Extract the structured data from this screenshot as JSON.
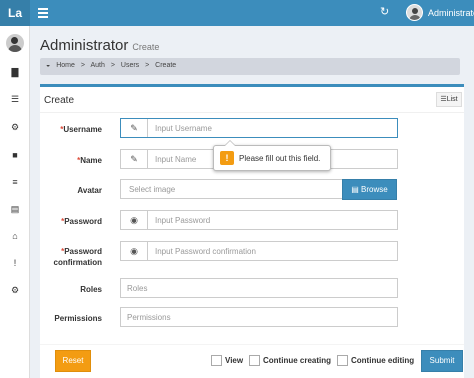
{
  "header": {
    "logo": "La",
    "user_name": "Administrator"
  },
  "page": {
    "title": "Administrator",
    "subtitle": "Create"
  },
  "breadcrumb": [
    {
      "label": "Home",
      "icon": "dashboard-icon"
    },
    {
      "label": ">"
    },
    {
      "label": "Auth"
    },
    {
      "label": ">"
    },
    {
      "label": "Users"
    },
    {
      "label": ">"
    },
    {
      "label": "Create"
    }
  ],
  "sidebar": {
    "icons": [
      "bar-chart-icon",
      "list-icon",
      "cogs-icon",
      "file-icon",
      "sliders-icon",
      "database-icon",
      "bank-icon",
      "exclamation-icon",
      "gears-icon"
    ]
  },
  "form": {
    "title": "Create",
    "list_button": "List",
    "username": {
      "label": "Username",
      "placeholder": "Input Username",
      "icon": "pencil-icon"
    },
    "name": {
      "label": "Name",
      "placeholder": "Input Name",
      "icon": "pencil-icon"
    },
    "avatar": {
      "label": "Avatar",
      "placeholder": "Select image",
      "browse": "Browse"
    },
    "password": {
      "label": "Password",
      "placeholder": "Input Password",
      "icon": "eye-icon"
    },
    "password_confirmation": {
      "label_line1": "Password",
      "label_line2": "confirmation",
      "placeholder": "Input Password confirmation",
      "icon": "eye-icon"
    },
    "roles": {
      "label": "Roles",
      "placeholder": "Roles"
    },
    "permissions": {
      "label": "Permissions",
      "placeholder": "Permissions"
    },
    "validation_message": "Please fill out this field."
  },
  "footer": {
    "reset": "Reset",
    "view": "View",
    "continue_creating": "Continue creating",
    "continue_editing": "Continue editing",
    "submit": "Submit"
  }
}
